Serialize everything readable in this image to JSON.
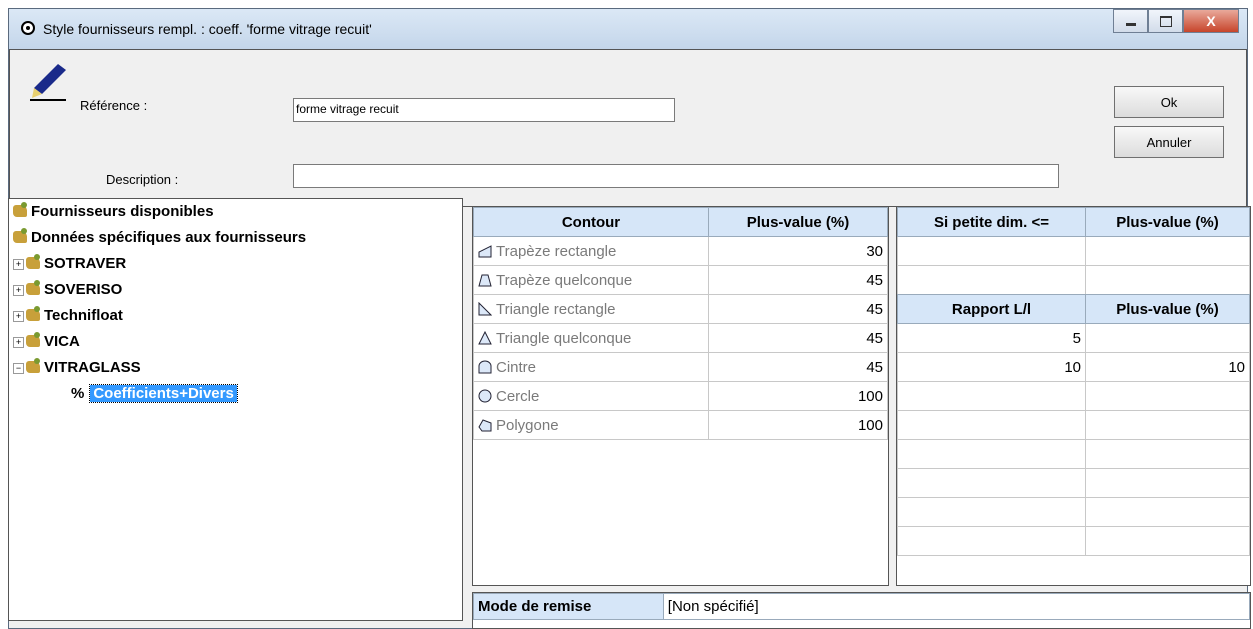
{
  "window": {
    "title": "Style fournisseurs rempl. : coeff. 'forme vitrage recuit'",
    "close_label": "X"
  },
  "form": {
    "reference_label": "Référence :",
    "reference_value": "forme vitrage recuit",
    "description_label": "Description :",
    "description_value": ""
  },
  "buttons": {
    "ok": "Ok",
    "cancel": "Annuler"
  },
  "tree": {
    "root1": "Fournisseurs disponibles",
    "root2": "Données spécifiques aux fournisseurs",
    "suppliers": [
      "SOTRAVER",
      "SOVERISO",
      "Technifloat",
      "VICA",
      "VITRAGLASS"
    ],
    "selected": "Coefficients+Divers",
    "selected_prefix": "%"
  },
  "contour_table": {
    "headers": [
      "Contour",
      "Plus-value (%)"
    ],
    "rows": [
      {
        "label": "Trapèze rectangle",
        "value": "30",
        "icon": "trapeze-rectangle-icon"
      },
      {
        "label": "Trapèze quelconque",
        "value": "45",
        "icon": "trapeze-quelconque-icon"
      },
      {
        "label": "Triangle rectangle",
        "value": "45",
        "icon": "triangle-rectangle-icon"
      },
      {
        "label": "Triangle quelconque",
        "value": "45",
        "icon": "triangle-quelconque-icon"
      },
      {
        "label": "Cintre",
        "value": "45",
        "icon": "cintre-icon"
      },
      {
        "label": "Cercle",
        "value": "100",
        "icon": "cercle-icon"
      },
      {
        "label": "Polygone",
        "value": "100",
        "icon": "polygone-icon"
      }
    ]
  },
  "petite_dim_table": {
    "headers": [
      "Si petite dim. <=",
      "Plus-value (%)"
    ]
  },
  "rapport_table": {
    "headers": [
      "Rapport L/l",
      "Plus-value (%)"
    ],
    "rows": [
      [
        "5",
        ""
      ],
      [
        "10",
        "10"
      ]
    ]
  },
  "remise": {
    "label": "Mode de remise",
    "value": "[Non spécifié]"
  },
  "colors": {
    "header_bg": "#d6e6f8",
    "selection": "#3399ff"
  }
}
